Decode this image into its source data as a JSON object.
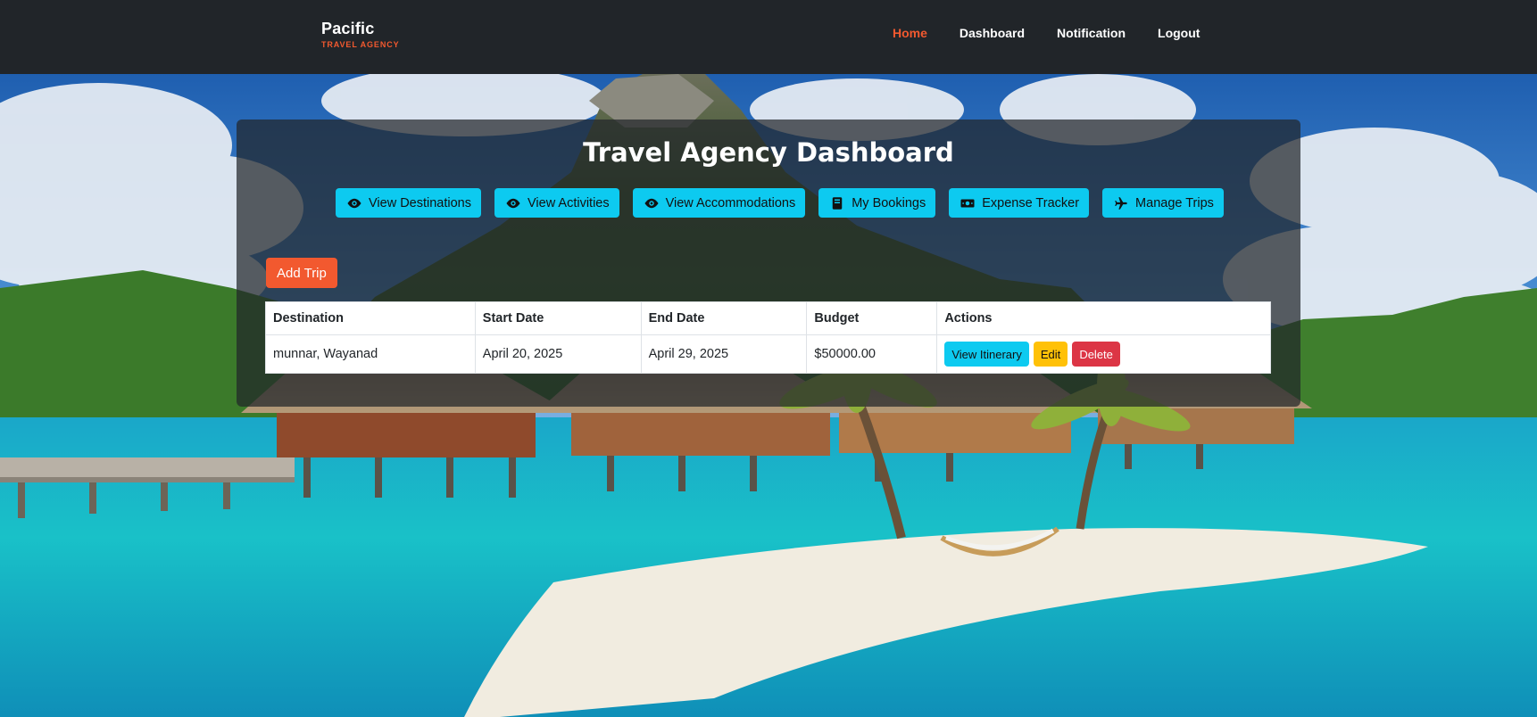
{
  "brand": {
    "name": "Pacific",
    "subtitle": "TRAVEL AGENCY"
  },
  "nav": {
    "items": [
      {
        "label": "Home",
        "active": true
      },
      {
        "label": "Dashboard",
        "active": false
      },
      {
        "label": "Notification",
        "active": false
      },
      {
        "label": "Logout",
        "active": false
      }
    ]
  },
  "dashboard": {
    "title": "Travel Agency Dashboard",
    "quick_actions": [
      {
        "label": "View Destinations",
        "icon": "eye-icon"
      },
      {
        "label": "View Activities",
        "icon": "eye-icon"
      },
      {
        "label": "View Accommodations",
        "icon": "eye-icon"
      },
      {
        "label": "My Bookings",
        "icon": "book-icon"
      },
      {
        "label": "Expense Tracker",
        "icon": "money-bill-icon"
      },
      {
        "label": "Manage Trips",
        "icon": "plane-icon"
      }
    ],
    "add_trip_label": "Add Trip"
  },
  "table": {
    "columns": [
      "Destination",
      "Start Date",
      "End Date",
      "Budget",
      "Actions"
    ],
    "rows": [
      {
        "destination": "munnar, Wayanad",
        "start_date": "April 20, 2025",
        "end_date": "April 29, 2025",
        "budget": "$50000.00"
      }
    ],
    "row_actions": {
      "view": "View Itinerary",
      "edit": "Edit",
      "delete": "Delete"
    }
  },
  "colors": {
    "accent": "#f2592f",
    "info": "#0dcaf0",
    "warning": "#ffc107",
    "danger": "#dc3545",
    "navbar": "#212529"
  }
}
